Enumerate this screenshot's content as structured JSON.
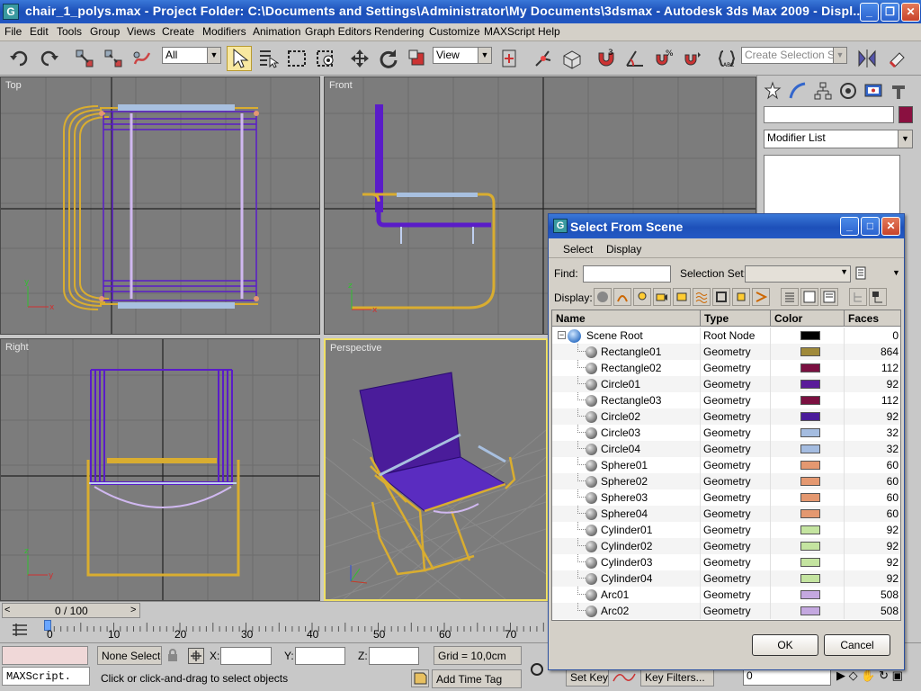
{
  "window": {
    "title": "chair_1_polys.max     - Project Folder: C:\\Documents and Settings\\Administrator\\My Documents\\3dsmax     - Autodesk 3ds Max  2009     - Displ...",
    "app_icon": "3ds-max-logo-icon",
    "min": "_",
    "max": "❐",
    "close": "✕"
  },
  "menu": [
    "File",
    "Edit",
    "Tools",
    "Group",
    "Views",
    "Create",
    "Modifiers",
    "Animation",
    "Graph Editors",
    "Rendering",
    "Customize",
    "MAXScript",
    "Help"
  ],
  "toolbar": {
    "filter_value": "All",
    "coord_value": "View",
    "named_selection_placeholder": "Create Selection Set"
  },
  "viewports": {
    "top": "Top",
    "front": "Front",
    "right": "Right",
    "perspective": "Perspective"
  },
  "command_panel": {
    "modifier_list": "Modifier List",
    "object_color": "#8a1040"
  },
  "dialog": {
    "title": "Select From Scene",
    "menu": [
      "Select",
      "Display"
    ],
    "find_label": "Find:",
    "find_value": "",
    "selection_set_label": "Selection Set:",
    "display_label": "Display:",
    "columns": [
      "Name",
      "Type",
      "Color",
      "Faces"
    ],
    "rows": [
      {
        "name": "Scene Root",
        "type": "Root Node",
        "color": "#000000",
        "faces": "0"
      },
      {
        "name": "Rectangle01",
        "type": "Geometry",
        "color": "#a08a3a",
        "faces": "864"
      },
      {
        "name": "Rectangle02",
        "type": "Geometry",
        "color": "#7a1040",
        "faces": "112"
      },
      {
        "name": "Circle01",
        "type": "Geometry",
        "color": "#5a1c9a",
        "faces": "92"
      },
      {
        "name": "Rectangle03",
        "type": "Geometry",
        "color": "#7a1040",
        "faces": "112"
      },
      {
        "name": "Circle02",
        "type": "Geometry",
        "color": "#4a1c9a",
        "faces": "92"
      },
      {
        "name": "Circle03",
        "type": "Geometry",
        "color": "#a4bce0",
        "faces": "32"
      },
      {
        "name": "Circle04",
        "type": "Geometry",
        "color": "#a4bce0",
        "faces": "32"
      },
      {
        "name": "Sphere01",
        "type": "Geometry",
        "color": "#e49870",
        "faces": "60"
      },
      {
        "name": "Sphere02",
        "type": "Geometry",
        "color": "#e49870",
        "faces": "60"
      },
      {
        "name": "Sphere03",
        "type": "Geometry",
        "color": "#e49870",
        "faces": "60"
      },
      {
        "name": "Sphere04",
        "type": "Geometry",
        "color": "#e49870",
        "faces": "60"
      },
      {
        "name": "Cylinder01",
        "type": "Geometry",
        "color": "#c4e4a0",
        "faces": "92"
      },
      {
        "name": "Cylinder02",
        "type": "Geometry",
        "color": "#c4e4a0",
        "faces": "92"
      },
      {
        "name": "Cylinder03",
        "type": "Geometry",
        "color": "#c4e4a0",
        "faces": "92"
      },
      {
        "name": "Cylinder04",
        "type": "Geometry",
        "color": "#c4e4a0",
        "faces": "92"
      },
      {
        "name": "Arc01",
        "type": "Geometry",
        "color": "#c4a8e0",
        "faces": "508"
      },
      {
        "name": "Arc02",
        "type": "Geometry",
        "color": "#c4a8e0",
        "faces": "508"
      }
    ],
    "ok": "OK",
    "cancel": "Cancel"
  },
  "timeline": {
    "frame_counter": "0 / 100",
    "prev": "<",
    "next": ">",
    "ticks": [
      "0",
      "10",
      "20",
      "30",
      "40",
      "50",
      "60",
      "70"
    ]
  },
  "status": {
    "maxscript": "MAXScript.",
    "selection": "None Selecte",
    "x_label": "X:",
    "y_label": "Y:",
    "z_label": "Z:",
    "grid": "Grid = 10,0cm",
    "prompt": "Click or click-and-drag to select objects",
    "add_time_tag": "Add Time Tag",
    "set_key": "Set Key",
    "key_filters": "Key Filters...",
    "frame": "0"
  }
}
